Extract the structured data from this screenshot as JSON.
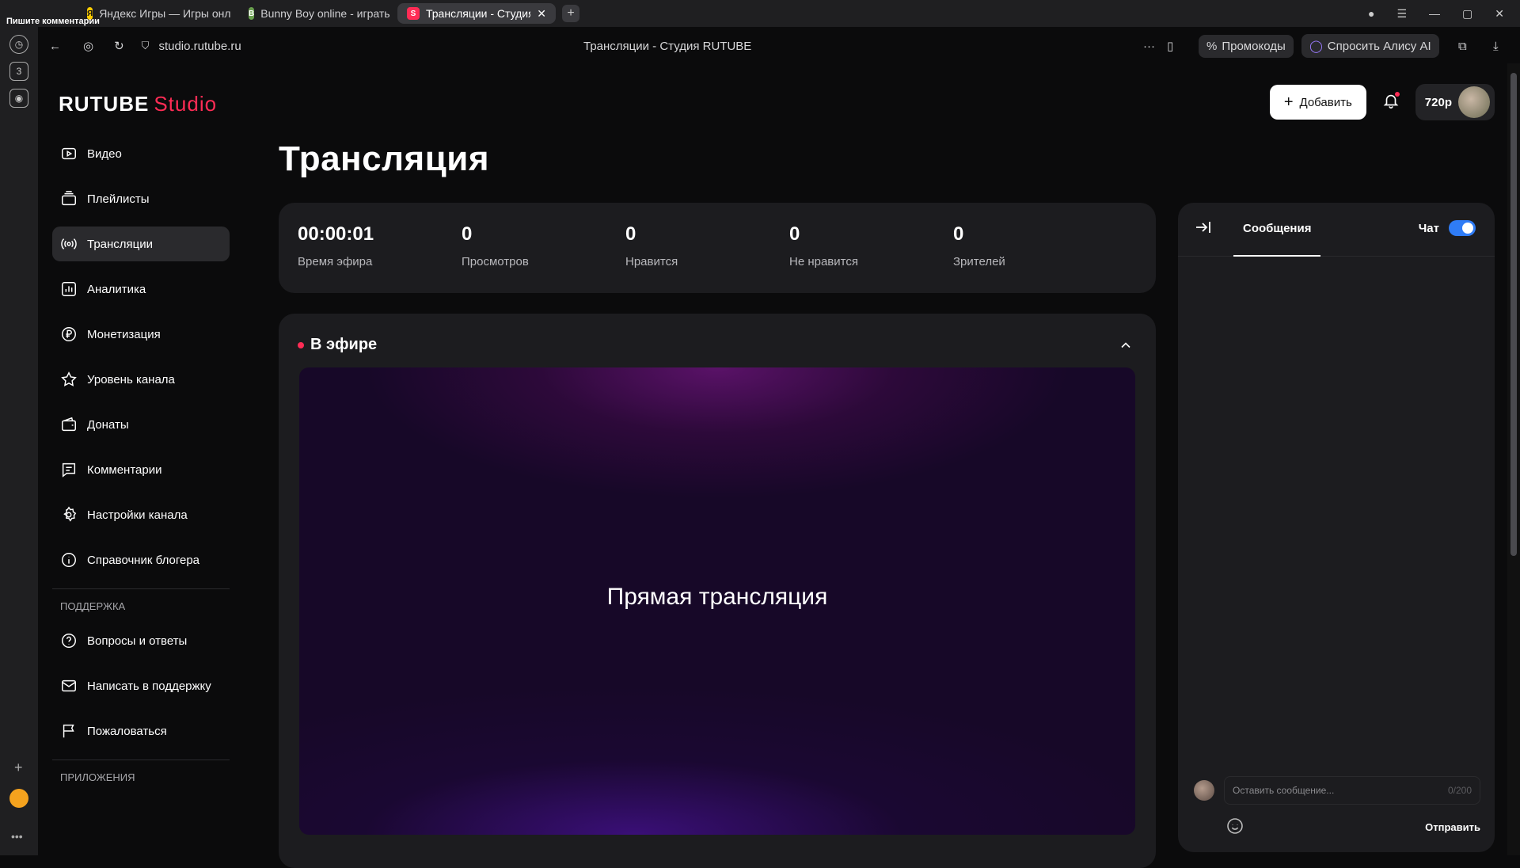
{
  "browser": {
    "tabs": [
      {
        "label": "Яндекс Игры — Игры онл",
        "fav": "Я"
      },
      {
        "label": "Bunny Boy online - играть",
        "fav": "B"
      },
      {
        "label": "Трансляции - Студия R",
        "fav": "S"
      }
    ],
    "overlay_text": "Пишите комментарии",
    "url": "studio.rutube.ru",
    "page_title": "Трансляции - Студия RUTUBE",
    "promo_label": "Промокоды",
    "alice_label": "Спросить Алису AI"
  },
  "header": {
    "logo_main": "RUTUBE",
    "logo_studio": "Studio",
    "add_label": "Добавить",
    "quality_label": "720p"
  },
  "sidebar": {
    "items": [
      {
        "label": "Видео",
        "icon": "video-icon"
      },
      {
        "label": "Плейлисты",
        "icon": "playlist-icon"
      },
      {
        "label": "Трансляции",
        "icon": "broadcast-icon"
      },
      {
        "label": "Аналитика",
        "icon": "analytics-icon"
      },
      {
        "label": "Монетизация",
        "icon": "ruble-icon"
      },
      {
        "label": "Уровень канала",
        "icon": "star-icon"
      },
      {
        "label": "Донаты",
        "icon": "wallet-icon"
      },
      {
        "label": "Комментарии",
        "icon": "comment-icon"
      },
      {
        "label": "Настройки канала",
        "icon": "gear-icon"
      },
      {
        "label": "Справочник блогера",
        "icon": "info-icon"
      }
    ],
    "support_title": "ПОДДЕРЖКА",
    "support_items": [
      {
        "label": "Вопросы и ответы",
        "icon": "question-icon"
      },
      {
        "label": "Написать в поддержку",
        "icon": "mail-icon"
      },
      {
        "label": "Пожаловаться",
        "icon": "flag-icon"
      }
    ],
    "apps_title": "ПРИЛОЖЕНИЯ"
  },
  "main": {
    "title": "Трансляция",
    "stats": [
      {
        "value": "00:00:01",
        "label": "Время эфира"
      },
      {
        "value": "0",
        "label": "Просмотров"
      },
      {
        "value": "0",
        "label": "Нравится"
      },
      {
        "value": "0",
        "label": "Не нравится"
      },
      {
        "value": "0",
        "label": "Зрителей"
      }
    ],
    "live_label": "В эфире",
    "player_text": "Прямая трансляция"
  },
  "chat": {
    "tab_label": "Сообщения",
    "chat_label": "Чат",
    "input_placeholder": "Оставить сообщение...",
    "counter": "0/200",
    "send_label": "Отправить"
  }
}
